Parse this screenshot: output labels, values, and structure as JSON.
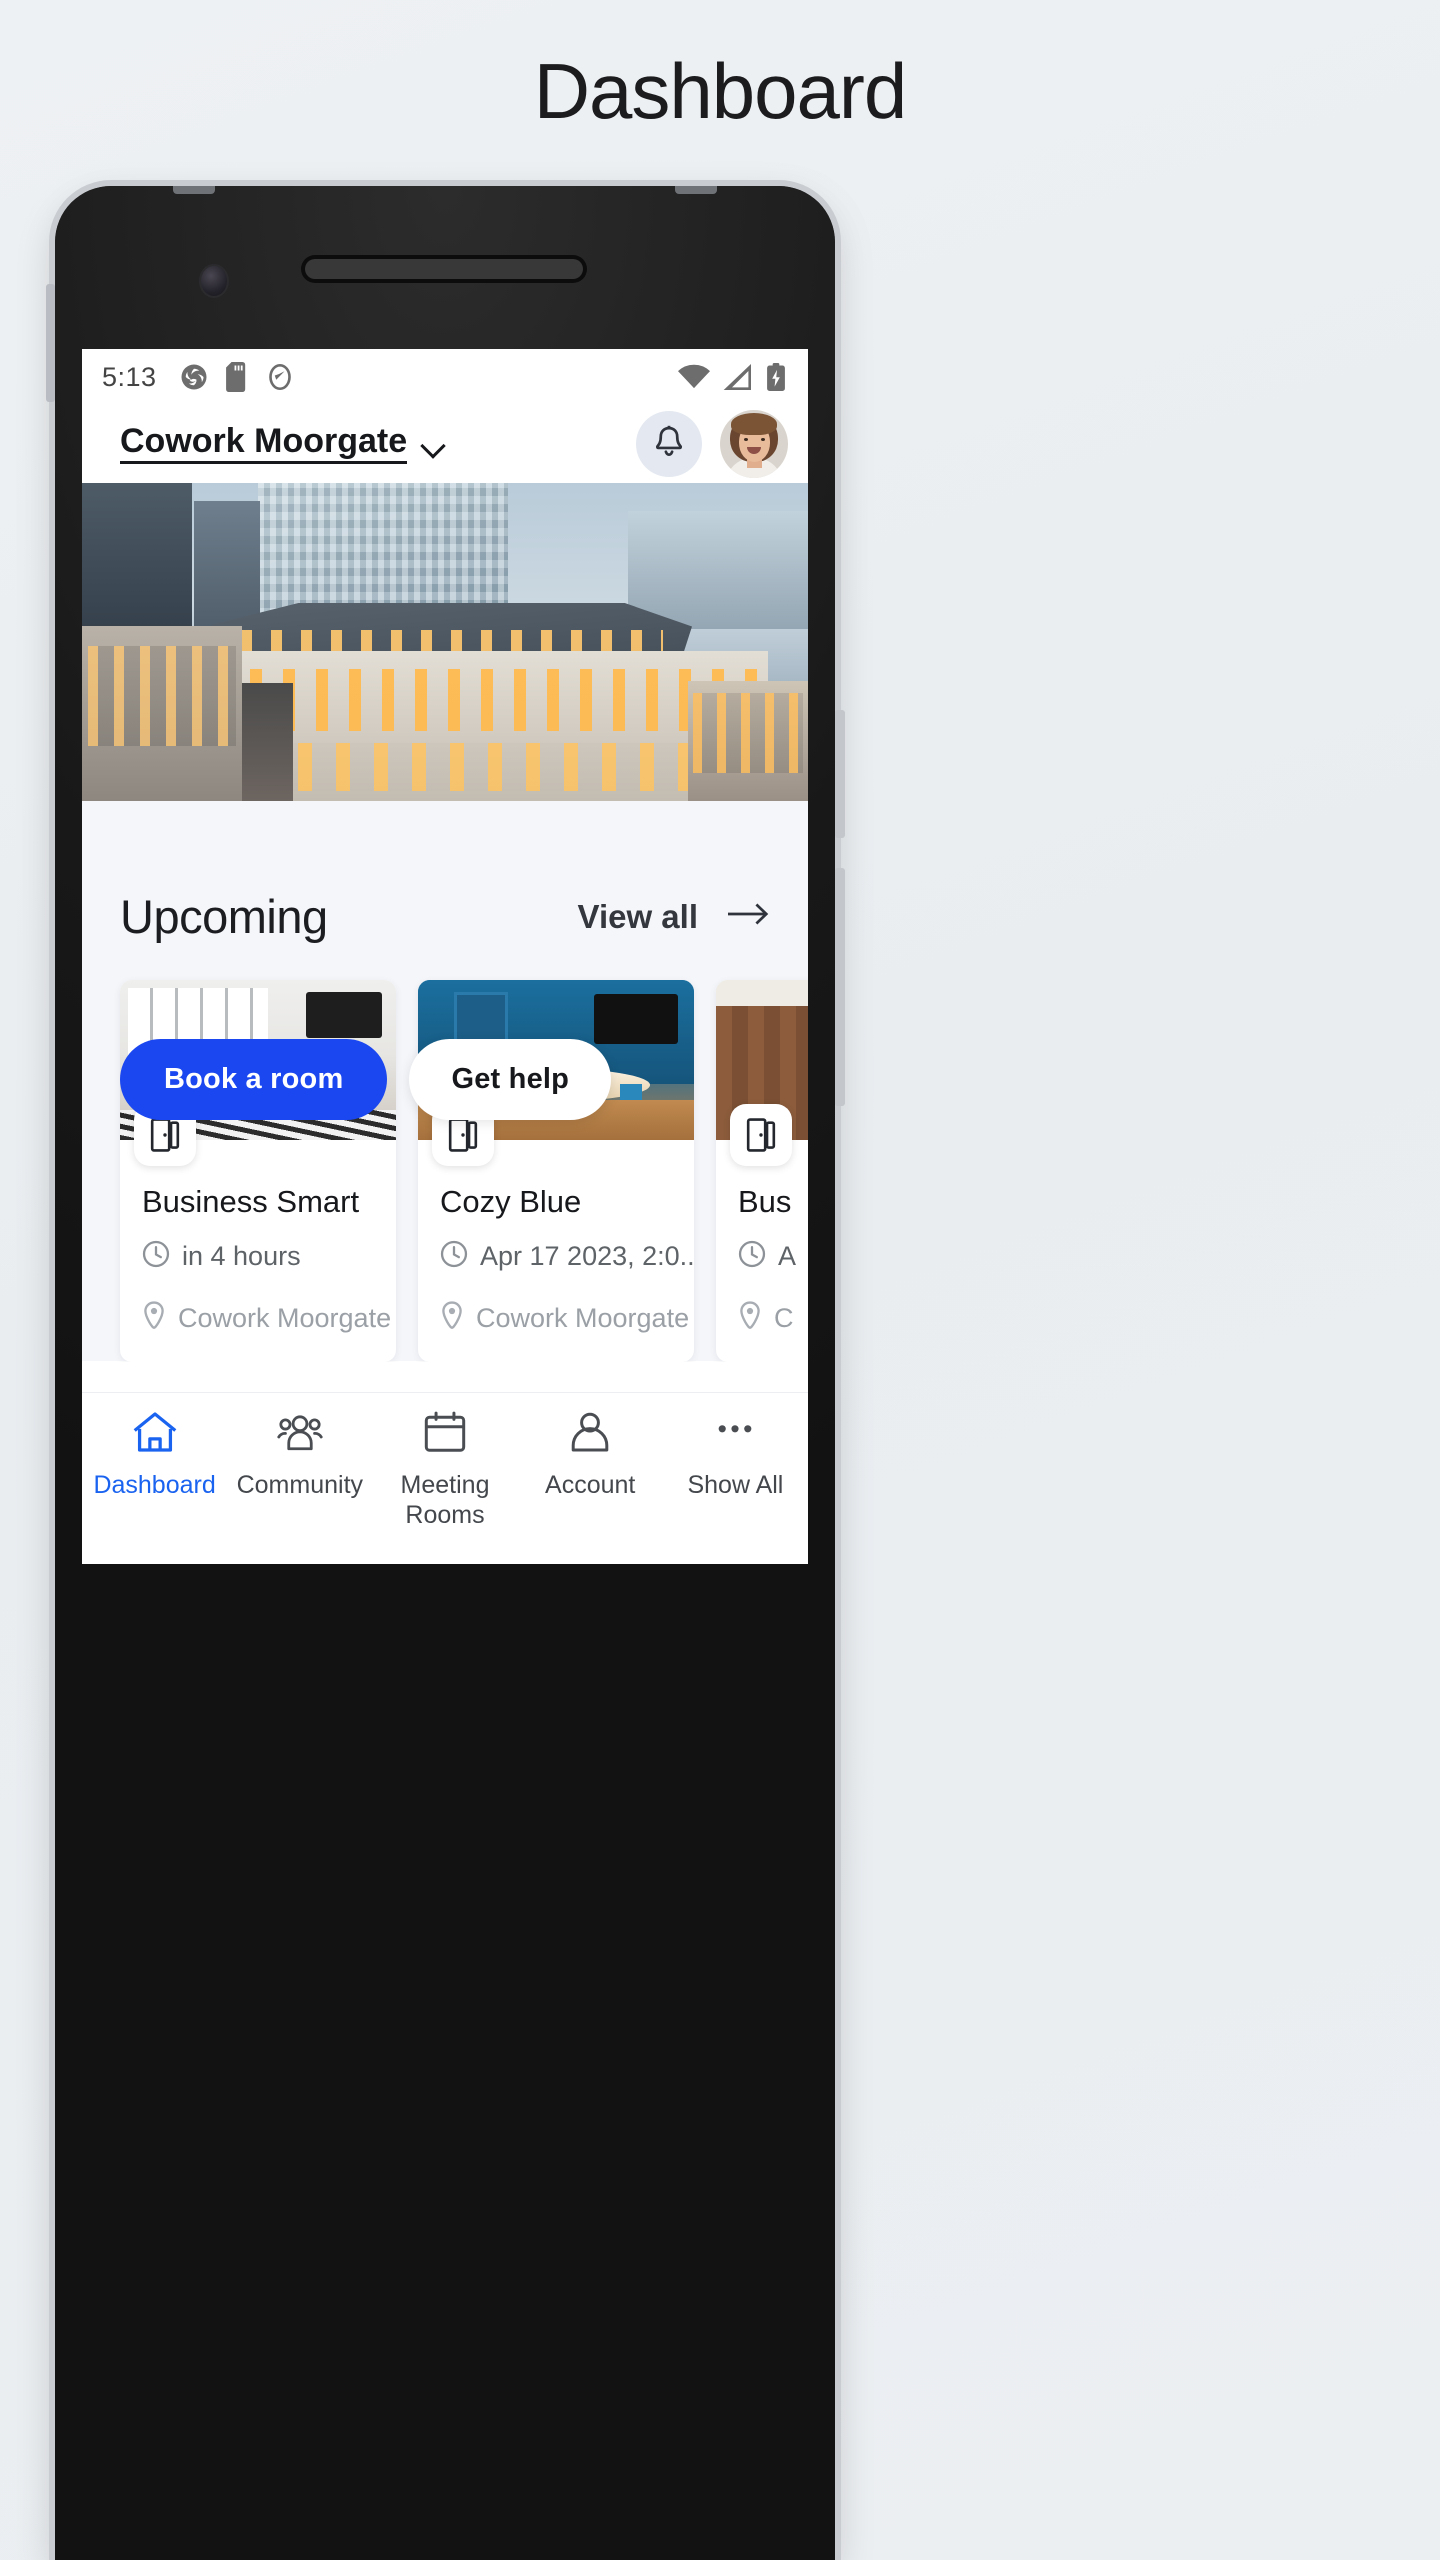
{
  "page": {
    "title": "Dashboard"
  },
  "statusbar": {
    "time": "5:13",
    "left_icons": [
      "app-logo-icon",
      "sd-card-icon",
      "sync-icon"
    ],
    "right_icons": [
      "wifi-icon",
      "cellular-signal-icon",
      "battery-charging-icon"
    ]
  },
  "header": {
    "location": "Cowork Moorgate",
    "chevron": "chevron-down-icon",
    "bell": "bell-icon",
    "avatar": "user-avatar"
  },
  "hero": {
    "alt": "Aerial photo of London office buildings at dusk"
  },
  "cta": {
    "primary": "Book a room",
    "secondary": "Get help"
  },
  "upcoming": {
    "title": "Upcoming",
    "view_all": "View all",
    "arrow": "arrow-right-icon",
    "cards": [
      {
        "title": "Business Smart",
        "time": "in 4 hours",
        "location": "Cowork Moorgate",
        "badge": "door-icon",
        "clock": "clock-icon",
        "pin": "location-pin-icon"
      },
      {
        "title": "Cozy Blue",
        "time": "Apr 17 2023, 2:0...",
        "location": "Cowork Moorgate",
        "badge": "door-icon",
        "clock": "clock-icon",
        "pin": "location-pin-icon"
      },
      {
        "title": "Bus",
        "time": "A",
        "location": "C",
        "badge": "door-icon",
        "clock": "clock-icon",
        "pin": "location-pin-icon"
      }
    ]
  },
  "bottom_nav": {
    "items": [
      {
        "label": "Dashboard",
        "icon": "home-icon",
        "active": true
      },
      {
        "label": "Community",
        "icon": "people-icon",
        "active": false
      },
      {
        "label": "Meeting Rooms",
        "icon": "calendar-icon",
        "active": false
      },
      {
        "label": "Account",
        "icon": "person-icon",
        "active": false
      },
      {
        "label": "Show All",
        "icon": "ellipsis-icon",
        "active": false
      }
    ]
  },
  "colors": {
    "accent": "#1a47f0",
    "nav_active": "#1a63f0",
    "page_bg": "#eceff1",
    "content_bg": "#f4f6fa"
  }
}
